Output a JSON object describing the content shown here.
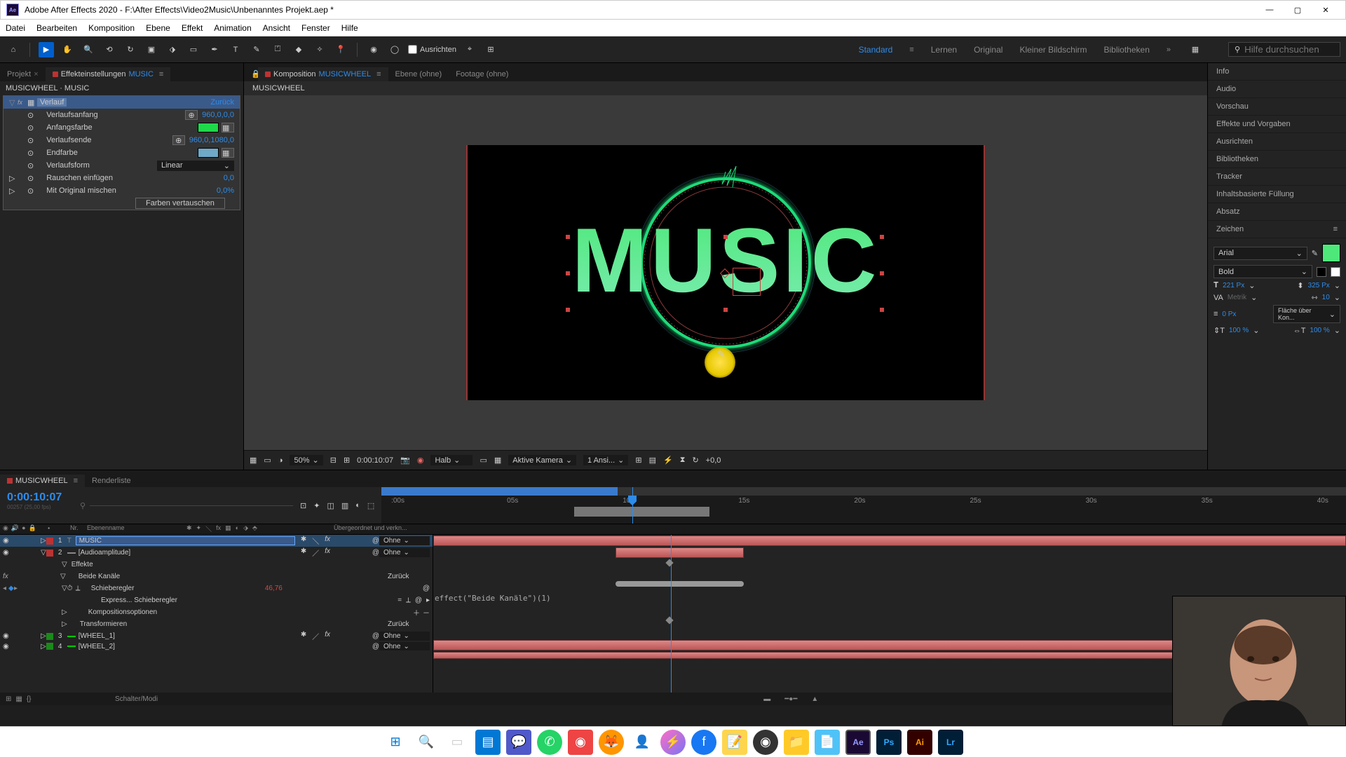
{
  "titlebar": {
    "app": "Adobe After Effects 2020",
    "project_path": "F:\\After Effects\\Video2Music\\Unbenanntes Projekt.aep *"
  },
  "menu": [
    "Datei",
    "Bearbeiten",
    "Komposition",
    "Ebene",
    "Effekt",
    "Animation",
    "Ansicht",
    "Fenster",
    "Hilfe"
  ],
  "toolbar": {
    "align_label": "Ausrichten"
  },
  "workspaces": {
    "items": [
      "Standard",
      "Lernen",
      "Original",
      "Kleiner Bildschirm",
      "Bibliotheken"
    ],
    "active": "Standard",
    "search_placeholder": "Hilfe durchsuchen"
  },
  "left_panel": {
    "tabs": {
      "project": "Projekt",
      "effect_controls": "Effekteinstellungen",
      "effect_target": "MUSIC"
    },
    "breadcrumb": "MUSICWHEEL · MUSIC",
    "effect": {
      "name": "Verlauf",
      "reset": "Zurück",
      "props": {
        "start": {
          "label": "Verlaufsanfang",
          "value": "960,0,0,0"
        },
        "startcolor": {
          "label": "Anfangsfarbe",
          "hex": "#1fd84a"
        },
        "end": {
          "label": "Verlaufsende",
          "value": "960,0,1080,0"
        },
        "endcolor": {
          "label": "Endfarbe",
          "hex": "#6fa8c8"
        },
        "shape": {
          "label": "Verlaufsform",
          "value": "Linear"
        },
        "noise": {
          "label": "Rauschen einfügen",
          "value": "0,0"
        },
        "blend": {
          "label": "Mit Original mischen",
          "value": "0,0%"
        },
        "swap": "Farben vertauschen"
      }
    }
  },
  "center": {
    "tabs": {
      "comp_prefix": "Komposition",
      "comp_name": "MUSICWHEEL",
      "layer": "Ebene (ohne)",
      "footage": "Footage (ohne)"
    },
    "breadcrumb": "MUSICWHEEL",
    "canvas_text": "MUSIC",
    "footer": {
      "mag": "50%",
      "timecode": "0:00:10:07",
      "res": "Halb",
      "camera": "Aktive Kamera",
      "views": "1 Ansi...",
      "exposure": "+0,0"
    }
  },
  "right_panel": {
    "sections": [
      "Info",
      "Audio",
      "Vorschau",
      "Effekte und Vorgaben",
      "Ausrichten",
      "Bibliotheken",
      "Tracker",
      "Inhaltsbasierte Füllung",
      "Absatz"
    ],
    "char": {
      "title": "Zeichen",
      "font": "Arial",
      "style": "Bold",
      "size": "221 Px",
      "leading": "325 Px",
      "kerning": "Metrik",
      "tracking": "10",
      "stroke": "0 Px",
      "stroke_opt": "Fläche über Kon...",
      "vscale": "100 %",
      "hscale": "100 %"
    }
  },
  "timeline": {
    "tab_name": "MUSICWHEEL",
    "render_tab": "Renderliste",
    "timecode": "0:00:10:07",
    "subtime": "00257 (25,00 fps)",
    "ruler_ticks": [
      ":00s",
      "05s",
      "10s",
      "15s",
      "20s",
      "25s",
      "30s",
      "35s",
      "40s"
    ],
    "cols": {
      "nr": "Nr.",
      "layer": "Ebenenname",
      "parent": "Übergeordnet und verkn..."
    },
    "rows": [
      {
        "num": "1",
        "name": "MUSIC",
        "type": "T",
        "color": "#b33",
        "parent": "Ohne"
      },
      {
        "num": "2",
        "name": "[Audioamplitude]",
        "type": "",
        "color": "#b33",
        "parent": "Ohne"
      }
    ],
    "sub": {
      "effects": "Effekte",
      "both": "Beide Kanäle",
      "both_reset": "Zurück",
      "slider": "Schieberegler",
      "slider_val": "46,76",
      "express": "Express... Schieberegler",
      "compopt": "Kompositionsoptionen",
      "transform": "Transformieren",
      "transform_reset": "Zurück"
    },
    "rows2": [
      {
        "num": "3",
        "name": "[WHEEL_1]",
        "color": "#1a8a1a",
        "parent": "Ohne"
      },
      {
        "num": "4",
        "name": "[WHEEL_2]",
        "color": "#1a8a1a",
        "parent": "Ohne"
      }
    ],
    "expression": "effect(\"Beide Kanäle\")(1)",
    "footer": "Schalter/Modi"
  }
}
